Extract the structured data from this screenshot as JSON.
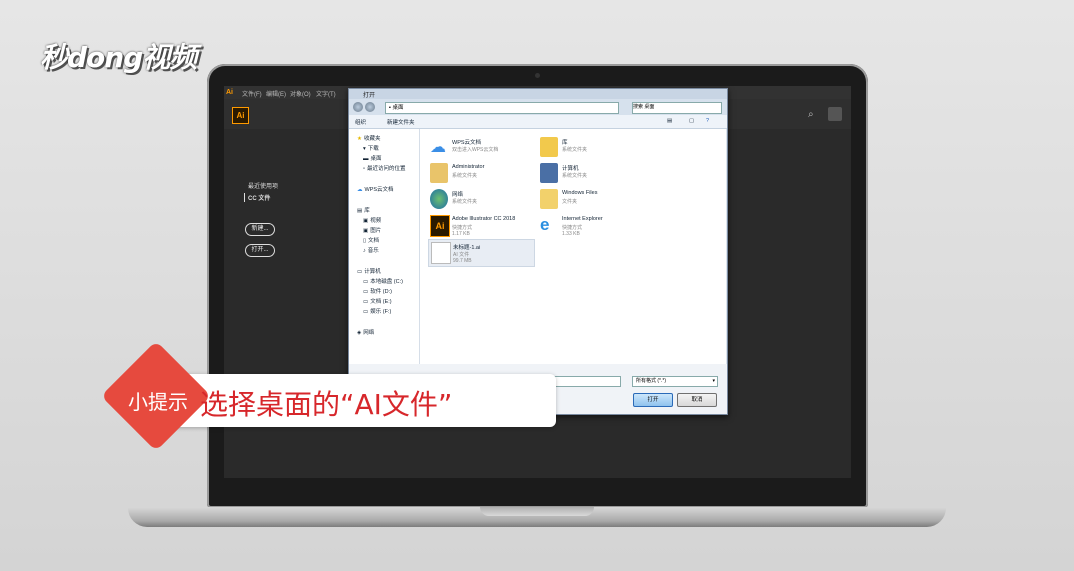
{
  "watermark": "秒dong视频",
  "ai_app": {
    "logo": "Ai",
    "menus": [
      "文件(F)",
      "编辑(E)",
      "对象(O)",
      "文字(T)"
    ],
    "sidebar": {
      "recent": "最近使用项",
      "cc_files": "CC 文件"
    },
    "new_button": "新建...",
    "open_button": "打开..."
  },
  "dialog": {
    "title": "打开",
    "address": "桌面",
    "search_placeholder": "搜索 桌面",
    "organize": "组织",
    "new_folder": "新建文件夹",
    "nav": {
      "favorites": "收藏夹",
      "downloads": "下载",
      "desktop": "桌面",
      "recent": "最近访问的位置",
      "wps_cloud": "WPS云文档",
      "library": "库",
      "video": "视频",
      "pictures": "图片",
      "documents": "文档",
      "music": "音乐",
      "computer": "计算机",
      "drive_c": "本地磁盘 (C:)",
      "drive_d": "软件 (D:)",
      "drive_e": "文档 (E:)",
      "drive_f": "娱乐 (F:)",
      "network": "网络"
    },
    "files": [
      {
        "name": "WPS云文档",
        "sub1": "双击进入WPS云文档",
        "sub2": "",
        "icon": "cloud-icon"
      },
      {
        "name": "库",
        "sub1": "系统文件夹",
        "sub2": "",
        "icon": "library-icon"
      },
      {
        "name": "Administrator",
        "sub1": "系统文件夹",
        "sub2": "",
        "icon": "user-folder-icon"
      },
      {
        "name": "计算机",
        "sub1": "系统文件夹",
        "sub2": "",
        "icon": "computer-icon"
      },
      {
        "name": "网络",
        "sub1": "系统文件夹",
        "sub2": "",
        "icon": "network-icon"
      },
      {
        "name": "Windows Files",
        "sub1": "文件夹",
        "sub2": "",
        "icon": "folder-icon"
      },
      {
        "name": "Adobe Illustrator CC 2018",
        "sub1": "快捷方式",
        "sub2": "1.17 KB",
        "icon": "illustrator-icon"
      },
      {
        "name": "Internet Explorer",
        "sub1": "快捷方式",
        "sub2": "1.33 KB",
        "icon": "ie-icon"
      },
      {
        "name": "未标题-1.ai",
        "sub1": "AI 文件",
        "sub2": "99.7 MB",
        "icon": "ai-file-icon"
      }
    ],
    "file_type": "所有格式 (*.*)",
    "open_button": "打开",
    "cancel_button": "取消"
  },
  "tip": {
    "label": "小提示",
    "text": "选择桌面的“AI文件”"
  },
  "colors": {
    "accent_red": "#e64a3e",
    "ai_orange": "#ff9a00"
  }
}
